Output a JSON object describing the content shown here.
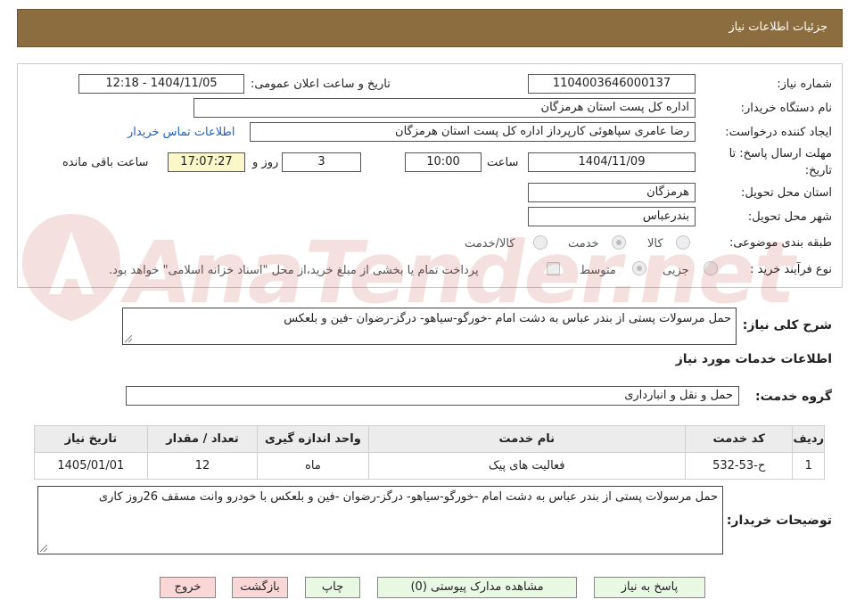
{
  "header": {
    "title": "جزئیات اطلاعات نیاز"
  },
  "form": {
    "need_number": {
      "label": "شماره نیاز:",
      "value": "1104003646000137"
    },
    "announce_datetime": {
      "label": "تاریخ و ساعت اعلان عمومی:",
      "value": "1404/11/05 - 12:18"
    },
    "buyer_org": {
      "label": "نام دستگاه خریدار:",
      "value": "اداره کل پست استان هرمزگان"
    },
    "requester": {
      "label": "ایجاد کننده درخواست:",
      "value": "رضا عامری سپاهوئی کارپرداز اداره کل پست استان هرمزگان",
      "contact_link": "اطلاعات تماس خریدار"
    },
    "deadline": {
      "label_line1": "مهلت ارسال پاسخ: تا",
      "label_line2": "تاریخ:",
      "date": "1404/11/09",
      "time_label": "ساعت",
      "time": "10:00",
      "days": "3",
      "days_label": "روز و",
      "remaining": "17:07:27",
      "remaining_label": "ساعت باقی مانده"
    },
    "delivery_province": {
      "label": "استان محل تحویل:",
      "value": "هرمزگان"
    },
    "delivery_city": {
      "label": "شهر محل تحویل:",
      "value": "بندرعباس"
    },
    "category": {
      "label": "طبقه بندی موضوعی:",
      "options": [
        "کالا",
        "خدمت",
        "کالا/خدمت"
      ],
      "selected": "خدمت"
    },
    "purchase_type": {
      "label": "نوع فرآیند خرید :",
      "options": [
        "جزیی",
        "متوسط"
      ],
      "selected": "متوسط",
      "payment_note": "پرداخت تمام یا بخشی از مبلغ خرید،از محل \"اسناد خزانه اسلامی\" خواهد بود."
    }
  },
  "description": {
    "label": "شرح کلی نیاز:",
    "value": "حمل مرسولات پستی از بندر عباس به دشت امام -خورگو-سیاهو- درگز-رضوان -فین و بلعکس"
  },
  "services_section": {
    "title": "اطلاعات خدمات مورد نیاز",
    "group_label": "گروه خدمت:",
    "group_value": "حمل و نقل و انبارداری"
  },
  "table": {
    "headers": [
      "ردیف",
      "کد خدمت",
      "نام خدمت",
      "واحد اندازه گیری",
      "تعداد / مقدار",
      "تاریخ نیاز"
    ],
    "rows": [
      [
        "1",
        "ح-53-532",
        "فعالیت های پیک",
        "ماه",
        "12",
        "1405/01/01"
      ]
    ]
  },
  "buyer_notes": {
    "label": "توضیحات خریدار:",
    "value": "حمل مرسولات پستی از بندر عباس به دشت امام -خورگو-سیاهو- درگز-رضوان -فین و بلعکس  با خودرو وانت مسقف 26روز کاری"
  },
  "buttons": {
    "reply": "پاسخ به نیاز",
    "attachments": "مشاهده مدارک پیوستی (0)",
    "print": "چاپ",
    "back": "بازگشت",
    "exit": "خروج"
  },
  "colors": {
    "header_bg": "#8b6d3f",
    "button_green": "#e8f8e3",
    "button_pink": "#fad7d7",
    "link": "#1a5fc7"
  }
}
